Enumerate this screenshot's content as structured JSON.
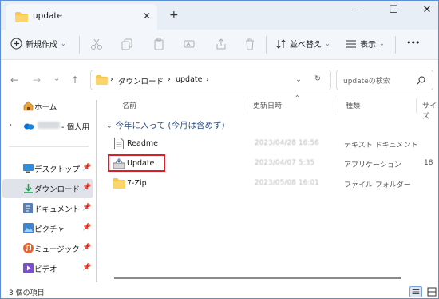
{
  "tab": {
    "title": "update",
    "close": "✕",
    "new_tab": "+"
  },
  "window_controls": {
    "minimize": "–",
    "maximize": "☐",
    "close": "✕"
  },
  "toolbar": {
    "new_label": "新規作成",
    "sort_label": "並べ替え",
    "view_label": "表示",
    "more_label": "•••"
  },
  "address": {
    "crumbs": [
      "ダウンロード",
      "update"
    ],
    "search_placeholder": "updateの検索"
  },
  "sidebar": {
    "items": [
      {
        "label": "ホーム",
        "icon": "home-icon"
      },
      {
        "label": "- 個人用",
        "icon": "onedrive-icon"
      },
      {
        "label": "デスクトップ",
        "icon": "desktop-icon"
      },
      {
        "label": "ダウンロード",
        "icon": "download-icon"
      },
      {
        "label": "ドキュメント",
        "icon": "documents-icon"
      },
      {
        "label": "ピクチャ",
        "icon": "pictures-icon"
      },
      {
        "label": "ミュージック",
        "icon": "music-icon"
      },
      {
        "label": "ビデオ",
        "icon": "videos-icon"
      }
    ]
  },
  "columns": {
    "name": "名前",
    "date": "更新日時",
    "type": "種類",
    "size": "サイズ"
  },
  "group_label": "今年に入って (今月は含めず)",
  "files": [
    {
      "name": "Readme",
      "date": "2023/04/28 16:56",
      "type": "テキスト ドキュメント",
      "size": ""
    },
    {
      "name": "Update",
      "date": "2023/04/07 5:35",
      "type": "アプリケーション",
      "size": "18"
    },
    {
      "name": "7-Zip",
      "date": "2023/05/08 16:01",
      "type": "ファイル フォルダー",
      "size": ""
    }
  ],
  "status": {
    "items_count": "3 個の項目"
  },
  "colors": {
    "accent": "#005fb8",
    "highlight": "#e11c26",
    "folder": "#f8c64c"
  }
}
